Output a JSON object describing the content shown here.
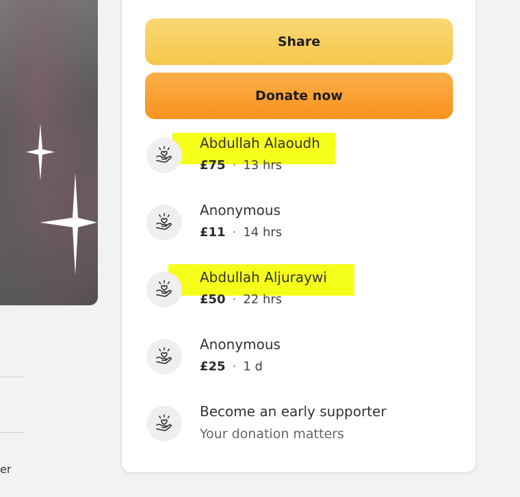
{
  "buttons": {
    "share_label": "Share",
    "donate_label": "Donate now"
  },
  "donations": [
    {
      "name": "Abdullah Alaoudh",
      "amount": "£75",
      "time": "13 hrs",
      "highlighted": true
    },
    {
      "name": "Anonymous",
      "amount": "£11",
      "time": "14 hrs",
      "highlighted": false
    },
    {
      "name": "Abdullah Aljuraywi",
      "amount": "£50",
      "time": "22 hrs",
      "highlighted": true
    },
    {
      "name": "Anonymous",
      "amount": "£25",
      "time": "1 d",
      "highlighted": false
    }
  ],
  "early_supporter": {
    "title": "Become an early supporter",
    "subtitle": "Your donation matters"
  },
  "left_fragment": "er",
  "colors": {
    "share_button": "#f6cc5a",
    "donate_button": "#f89a2a",
    "highlight": "#f5ff1a"
  },
  "icons": {
    "donation": "heart-hand-icon",
    "sparkle": "sparkle-icon"
  }
}
